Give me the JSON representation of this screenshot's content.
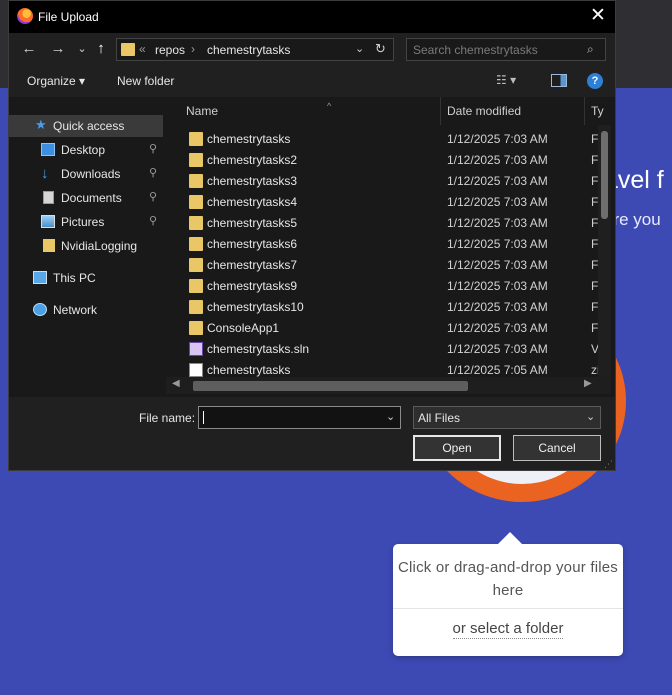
{
  "dialog": {
    "title": "File Upload",
    "close_glyph": "✕",
    "nav": {
      "back": "←",
      "forward": "→",
      "recent": "⌄",
      "up": "↑"
    },
    "address": {
      "overflow": "«",
      "segments": [
        "repos",
        "chemestrytasks"
      ],
      "separator": "›",
      "dropdown": "⌄",
      "refresh": "↻"
    },
    "search": {
      "placeholder": "Search chemestrytasks"
    },
    "toolbar": {
      "organize": "Organize ▾",
      "new_folder": "New folder",
      "view": "☷ ▾",
      "help": "?"
    },
    "nav_pane": [
      {
        "label": "Quick access",
        "icon": "star-icon",
        "selected": true
      },
      {
        "label": "Desktop",
        "icon": "desktop-icon",
        "pinned": "📌"
      },
      {
        "label": "Downloads",
        "icon": "download-icon",
        "pinned": "📌"
      },
      {
        "label": "Documents",
        "icon": "document-icon",
        "pinned": "📌"
      },
      {
        "label": "Pictures",
        "icon": "picture-icon",
        "pinned": "📌"
      },
      {
        "label": "NvidiaLogging",
        "icon": "folder-icon"
      },
      {
        "label": "This PC",
        "icon": "computer-icon"
      },
      {
        "label": "Network",
        "icon": "network-icon"
      }
    ],
    "columns": {
      "name": "Name",
      "date": "Date modified",
      "type": "Ty"
    },
    "files": [
      {
        "name": "chemestrytasks",
        "date": "1/12/2025 7:03 AM",
        "type": "Fi",
        "icon": "folder"
      },
      {
        "name": "chemestrytasks2",
        "date": "1/12/2025 7:03 AM",
        "type": "Fi",
        "icon": "folder"
      },
      {
        "name": "chemestrytasks3",
        "date": "1/12/2025 7:03 AM",
        "type": "Fi",
        "icon": "folder"
      },
      {
        "name": "chemestrytasks4",
        "date": "1/12/2025 7:03 AM",
        "type": "Fi",
        "icon": "folder"
      },
      {
        "name": "chemestrytasks5",
        "date": "1/12/2025 7:03 AM",
        "type": "Fi",
        "icon": "folder"
      },
      {
        "name": "chemestrytasks6",
        "date": "1/12/2025 7:03 AM",
        "type": "Fi",
        "icon": "folder"
      },
      {
        "name": "chemestrytasks7",
        "date": "1/12/2025 7:03 AM",
        "type": "Fi",
        "icon": "folder"
      },
      {
        "name": "chemestrytasks9",
        "date": "1/12/2025 7:03 AM",
        "type": "Fi",
        "icon": "folder"
      },
      {
        "name": "chemestrytasks10",
        "date": "1/12/2025 7:03 AM",
        "type": "Fi",
        "icon": "folder"
      },
      {
        "name": "ConsoleApp1",
        "date": "1/12/2025 7:03 AM",
        "type": "Fi",
        "icon": "folder"
      },
      {
        "name": "chemestrytasks.sln",
        "date": "1/12/2025 7:03 AM",
        "type": "Vi",
        "icon": "sln"
      },
      {
        "name": "chemestrytasks",
        "date": "1/12/2025 7:05 AM",
        "type": "zi",
        "icon": "zip"
      }
    ],
    "bottom": {
      "file_name_label": "File name:",
      "file_name_value": "",
      "file_type": "All Files",
      "open_label": "Open",
      "cancel_label": "Cancel"
    }
  },
  "page": {
    "heading_fragment": "avel f",
    "subheading_fragment": "are you",
    "drop_text": "Click or drag-and-drop your files here",
    "select_folder": "or select a folder"
  },
  "colors": {
    "page_bg": "#3d4ab4",
    "accent_orange": "#ea6320",
    "dialog_bg": "#202020",
    "selection": "#3a3a3a"
  }
}
